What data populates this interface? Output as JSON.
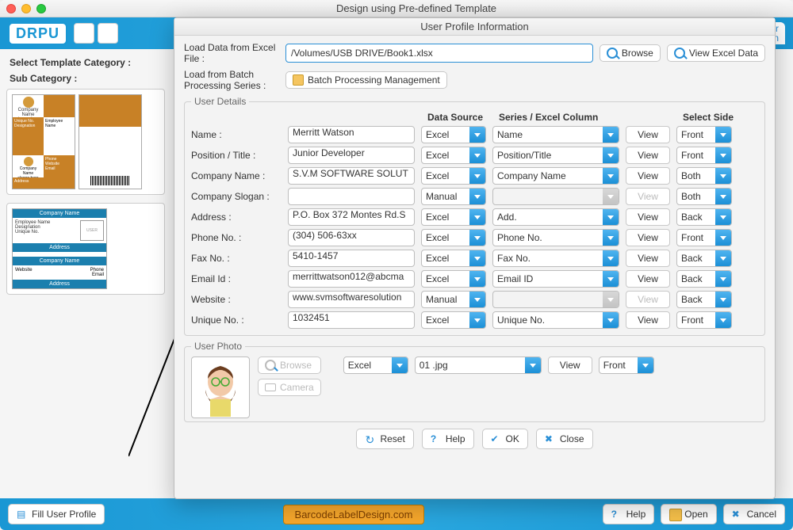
{
  "window": {
    "title": "Design using Pre-defined Template"
  },
  "main": {
    "logo": "DRPU",
    "right_suffix": "er\non",
    "select_template": "Select Template Category :",
    "sub_category": "Sub Category :"
  },
  "bottom": {
    "fill_profile": "Fill User Profile",
    "link": "BarcodeLabelDesign.com",
    "help": "Help",
    "open": "Open",
    "cancel": "Cancel"
  },
  "dialog": {
    "title": "User Profile Information",
    "load_label": "Load Data from Excel File :",
    "path": "/Volumes/USB DRIVE/Book1.xlsx",
    "browse": "Browse",
    "view_excel": "View Excel Data",
    "load_batch_label": "Load from Batch Processing Series :",
    "batch_btn": "Batch Processing Management",
    "user_details_legend": "User Details",
    "headers": {
      "data_source": "Data Source",
      "series_col": "Series / Excel Column",
      "select_side": "Select Side"
    },
    "view_label": "View",
    "rows": [
      {
        "label": "Name :",
        "value": "Merritt Watson",
        "source": "Excel",
        "col": "Name",
        "view_enabled": true,
        "side": "Front"
      },
      {
        "label": "Position / Title :",
        "value": "Junior Developer",
        "source": "Excel",
        "col": "Position/Title",
        "view_enabled": true,
        "side": "Front"
      },
      {
        "label": "Company Name :",
        "value": "S.V.M SOFTWARE SOLUT",
        "source": "Excel",
        "col": "Company Name",
        "view_enabled": true,
        "side": "Both"
      },
      {
        "label": "Company Slogan :",
        "value": "",
        "source": "Manual",
        "col": "",
        "view_enabled": false,
        "side": "Both"
      },
      {
        "label": "Address :",
        "value": "P.O. Box 372 Montes Rd.S",
        "source": "Excel",
        "col": "Add.",
        "view_enabled": true,
        "side": "Back"
      },
      {
        "label": "Phone No. :",
        "value": "(304) 506-63xx",
        "source": "Excel",
        "col": "Phone No.",
        "view_enabled": true,
        "side": "Front"
      },
      {
        "label": "Fax No. :",
        "value": "5410-1457",
        "source": "Excel",
        "col": "Fax No.",
        "view_enabled": true,
        "side": "Back"
      },
      {
        "label": "Email Id :",
        "value": "merrittwatson012@abcma",
        "source": "Excel",
        "col": "Email ID",
        "view_enabled": true,
        "side": "Back"
      },
      {
        "label": "Website :",
        "value": "www.svmsoftwaresolution",
        "source": "Manual",
        "col": "",
        "view_enabled": false,
        "side": "Back"
      },
      {
        "label": "Unique No. :",
        "value": "1032451",
        "source": "Excel",
        "col": "Unique No.",
        "view_enabled": true,
        "side": "Front"
      }
    ],
    "user_photo_legend": "User Photo",
    "photo_browse": "Browse",
    "photo_camera": "Camera",
    "photo_source": "Excel",
    "photo_col": "01 .jpg",
    "photo_side": "Front",
    "footer": {
      "reset": "Reset",
      "help": "Help",
      "ok": "OK",
      "close": "Close"
    }
  }
}
